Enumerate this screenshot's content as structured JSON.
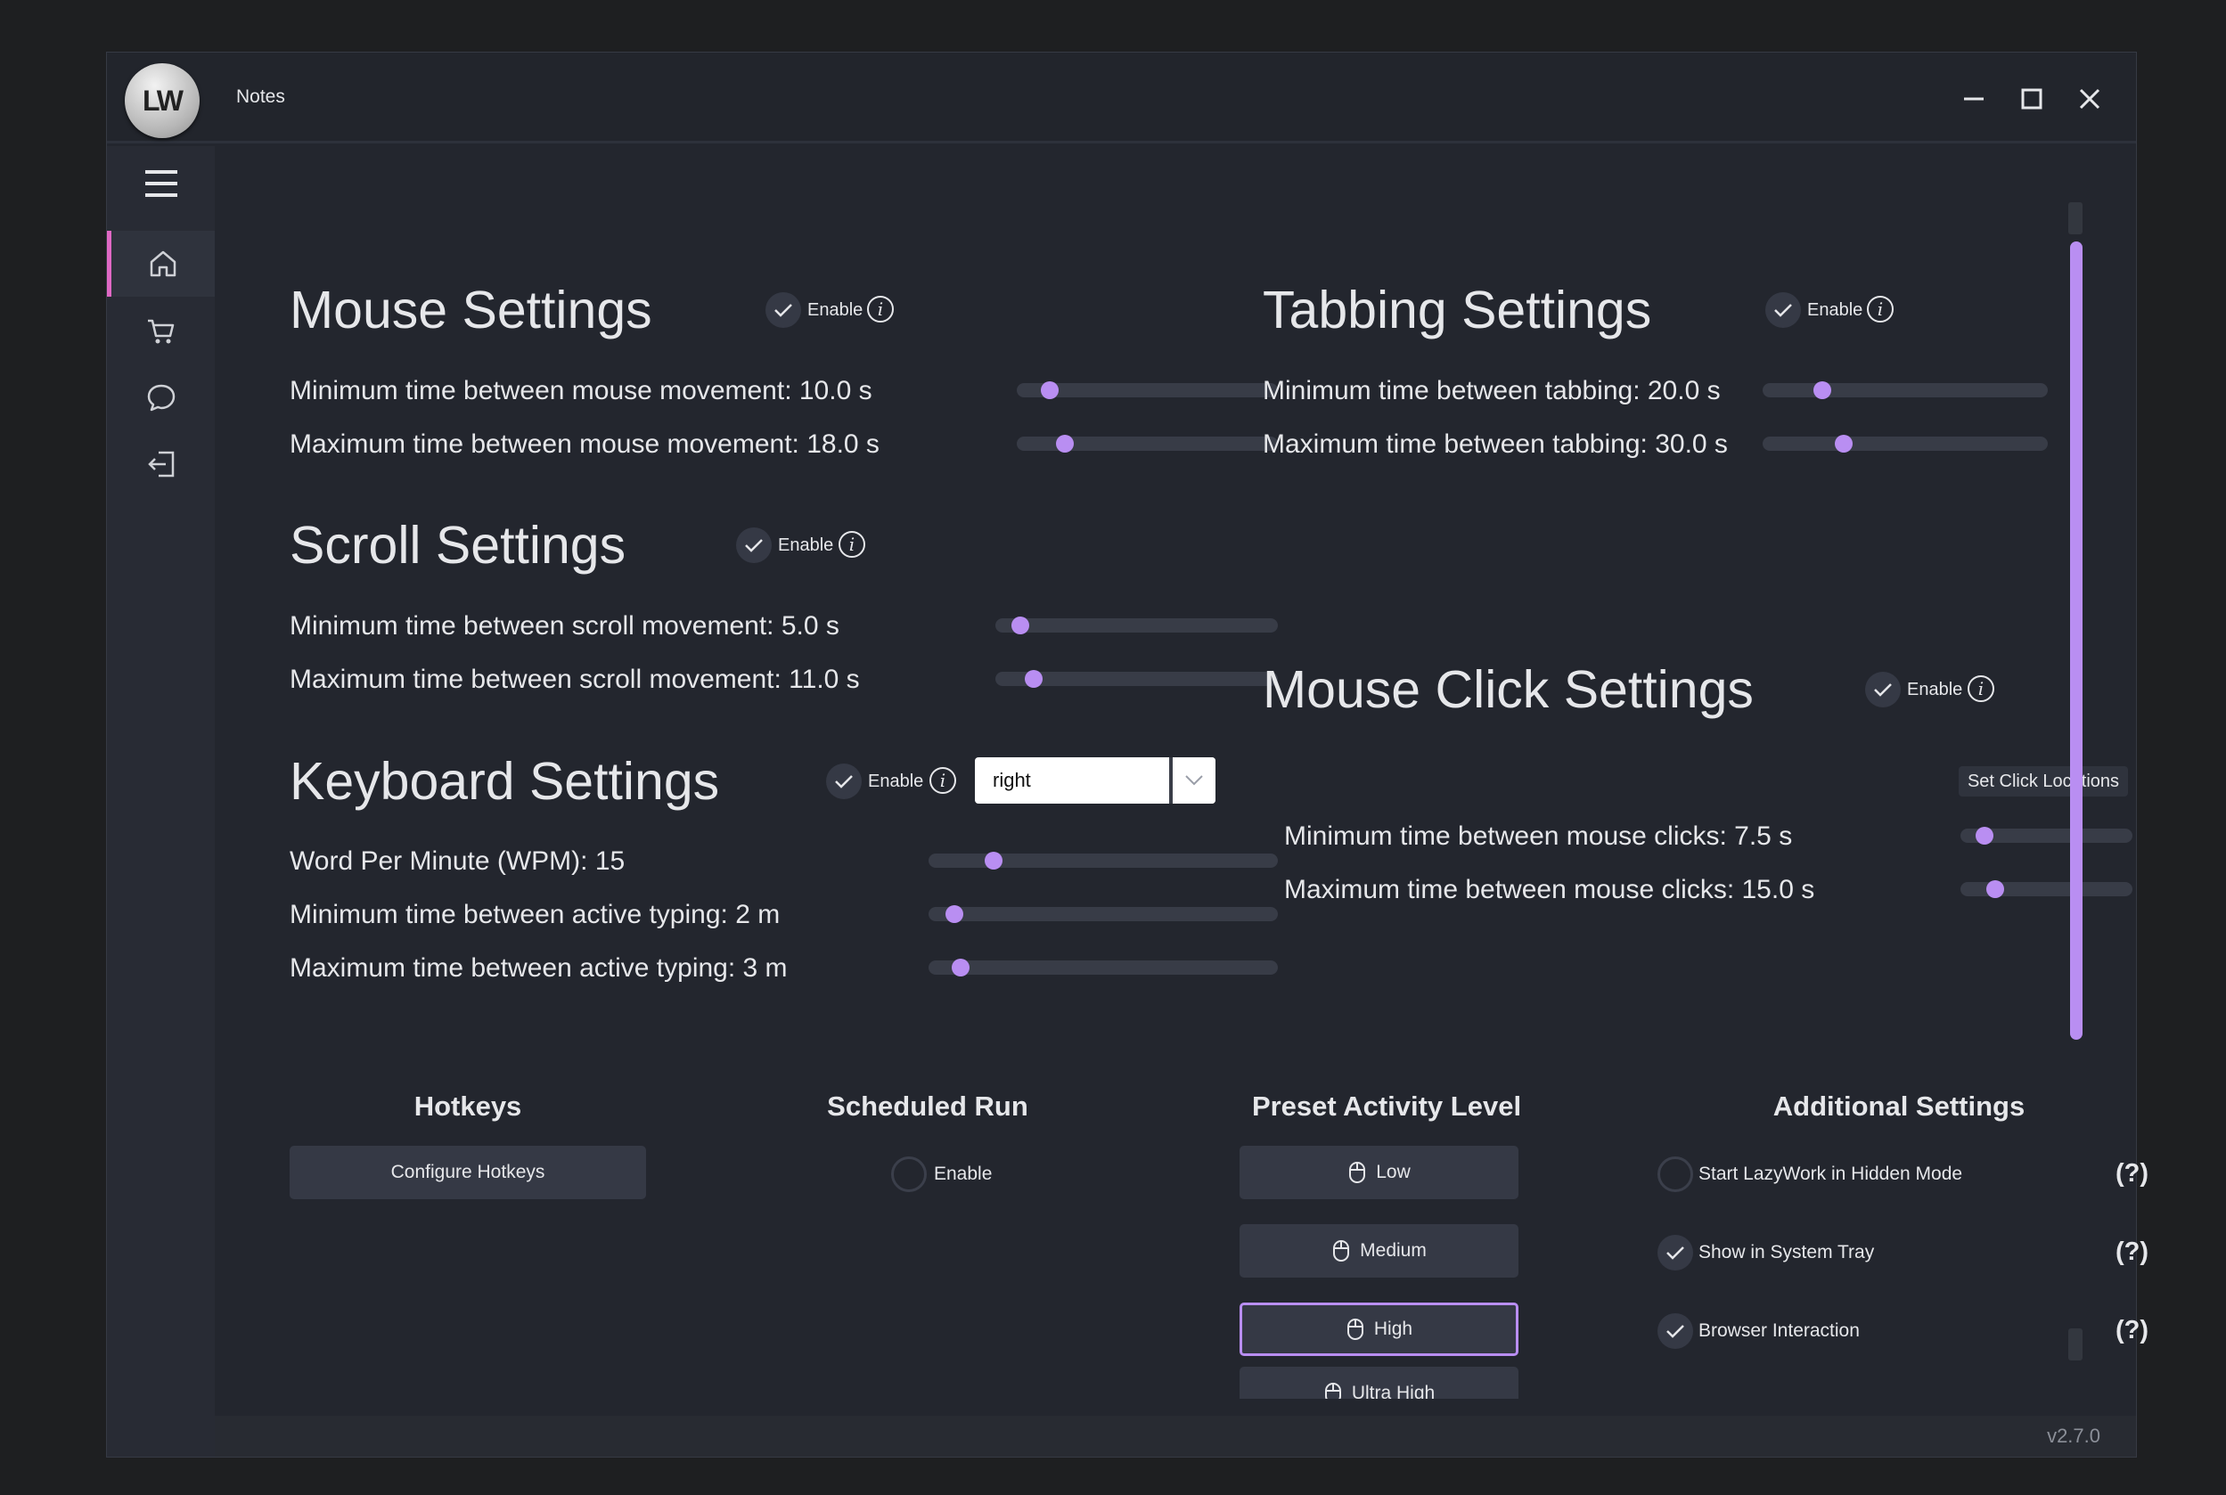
{
  "window": {
    "logo_text": "LW",
    "title": "Notes",
    "version": "v2.7.0"
  },
  "nav": [
    "home-icon",
    "cart-icon",
    "chat-icon",
    "logout-icon"
  ],
  "mouse": {
    "title": "Mouse Settings",
    "enable": "Enable",
    "enabled": true,
    "min_label": "Minimum time between mouse movement: 10.0 s",
    "min_value": 0.1,
    "max_label": "Maximum time between mouse movement: 18.0 s",
    "max_value": 0.16
  },
  "scroll": {
    "title": "Scroll Settings",
    "enable": "Enable",
    "enabled": true,
    "min_label": "Minimum time between scroll movement: 5.0 s",
    "min_value": 0.06,
    "max_label": "Maximum time between scroll movement: 11.0 s",
    "max_value": 0.11
  },
  "keyboard": {
    "title": "Keyboard Settings",
    "enable": "Enable",
    "enabled": true,
    "select_value": "right",
    "wpm_label": "Word Per Minute (WPM): 15",
    "wpm_value": 0.17,
    "min_label": "Minimum time between active typing: 2 m",
    "min_value": 0.05,
    "max_label": "Maximum time between active typing: 3 m",
    "max_value": 0.07
  },
  "tabbing": {
    "title": "Tabbing Settings",
    "enable": "Enable",
    "enabled": true,
    "min_label": "Minimum time between tabbing: 20.0 s",
    "min_value": 0.19,
    "max_label": "Maximum time between tabbing: 30.0 s",
    "max_value": 0.27
  },
  "click": {
    "title": "Mouse Click Settings",
    "enable": "Enable",
    "enabled": true,
    "locations_button": "Set Click Locations",
    "min_label": "Minimum time between mouse clicks: 7.5 s",
    "min_value": 0.1,
    "max_label": "Maximum time between mouse clicks: 15.0 s",
    "max_value": 0.17
  },
  "hotkeys": {
    "title": "Hotkeys",
    "button": "Configure Hotkeys"
  },
  "scheduled": {
    "title": "Scheduled Run",
    "enable": "Enable",
    "enabled": false
  },
  "preset": {
    "title": "Preset Activity Level",
    "levels": [
      "Low",
      "Medium",
      "High",
      "Ultra High"
    ],
    "selected": "High"
  },
  "additional": {
    "title": "Additional Settings",
    "options": [
      {
        "label": "Start LazyWork in Hidden Mode",
        "checked": false,
        "help": "(?)"
      },
      {
        "label": "Show in System Tray",
        "checked": true,
        "help": "(?)"
      },
      {
        "label": "Browser Interaction",
        "checked": true,
        "help": "(?)"
      }
    ]
  }
}
